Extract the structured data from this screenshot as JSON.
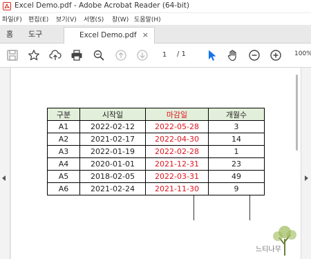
{
  "window": {
    "title": "Excel Demo.pdf - Adobe Acrobat Reader (64-bit)"
  },
  "menu": {
    "items": [
      "파일(F)",
      "편집(E)",
      "보기(V)",
      "서명(S)",
      "창(W)",
      "도움말(H)"
    ]
  },
  "tabs": {
    "home": "홈",
    "tools": "도구",
    "document": "Excel Demo.pdf",
    "close": "×"
  },
  "toolbar": {
    "page_current": "1",
    "page_separator": "/ 1",
    "zoom": "100%",
    "icons": [
      "save-icon",
      "bookmark-star-icon",
      "cloud-upload-icon",
      "print-icon",
      "search-zoom-icon",
      "page-up-icon",
      "page-down-icon",
      "select-cursor-icon",
      "hand-tool-icon",
      "zoom-out-icon",
      "zoom-in-icon"
    ],
    "accent_color": "#1473e6"
  },
  "table": {
    "headers": [
      "구분",
      "시작일",
      "마감일",
      "개월수"
    ],
    "header_colors": [
      "#000000",
      "#000000",
      "#e0141e",
      "#000000"
    ],
    "rows": [
      [
        "A1",
        "2022-02-12",
        "2022-05-28",
        "3"
      ],
      [
        "A2",
        "2021-02-17",
        "2022-04-30",
        "14"
      ],
      [
        "A3",
        "2022-01-19",
        "2022-02-28",
        "1"
      ],
      [
        "A4",
        "2020-01-01",
        "2021-12-31",
        "23"
      ],
      [
        "A5",
        "2018-02-05",
        "2022-03-31",
        "49"
      ],
      [
        "A6",
        "2021-02-24",
        "2021-11-30",
        "9"
      ]
    ],
    "header_fill": "#e2efda",
    "due_date_color": "#e0141e"
  },
  "watermark": {
    "text": "느티나무"
  }
}
